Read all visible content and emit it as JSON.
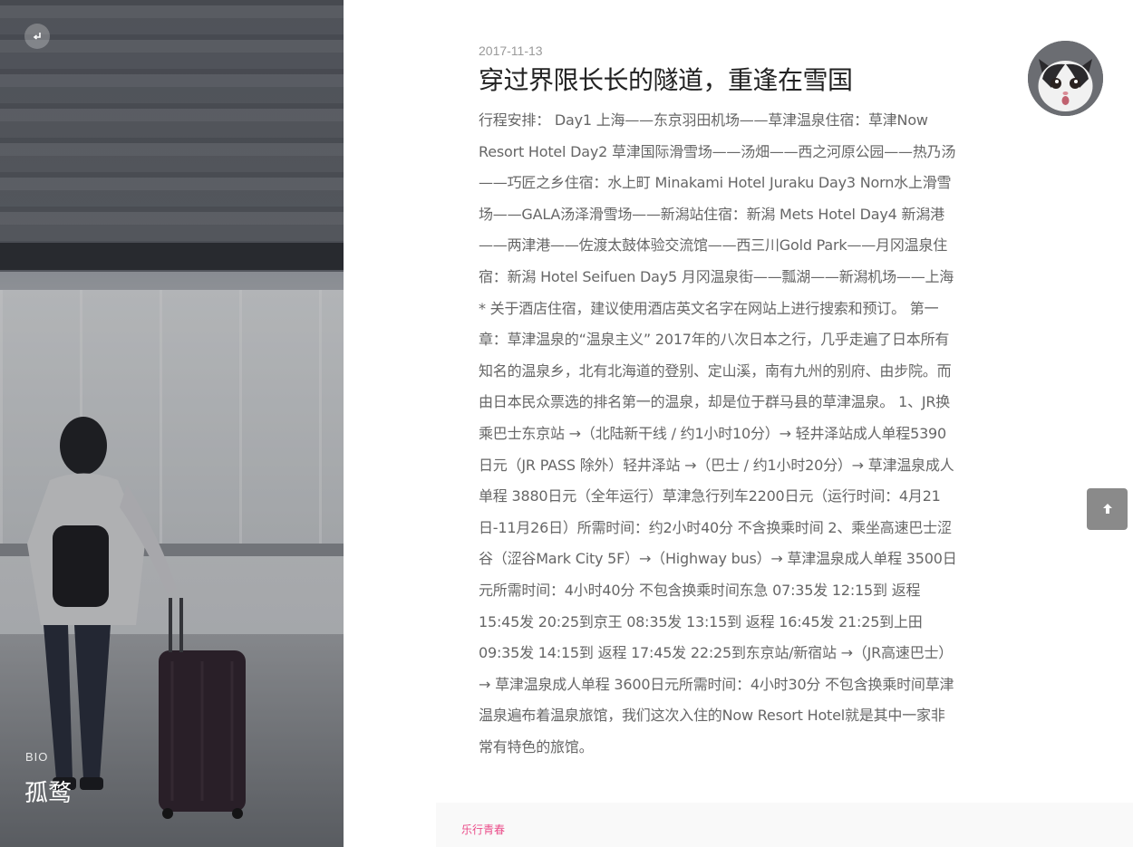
{
  "sidebar": {
    "bio_label": "BIO",
    "bio_name": "孤鹜",
    "back_icon": "back-arrow-icon"
  },
  "post": {
    "date": "2017-11-13",
    "title": "穿过界限长长的隧道，重逢在雪国",
    "body": "行程安排： Day1 上海——东京羽田机场——草津温泉住宿：草津Now Resort Hotel Day2 草津国际滑雪场——汤畑——西之河原公园——热乃汤——巧匠之乡住宿：水上町 Minakami Hotel Juraku Day3 Norn水上滑雪场——GALA汤泽滑雪场——新潟站住宿：新潟 Mets Hotel Day4 新潟港——两津港——佐渡太鼓体验交流馆——西三川Gold Park——月冈温泉住宿：新潟 Hotel Seifuen Day5 月冈温泉街——瓢湖——新潟机场——上海 * 关于酒店住宿，建议使用酒店英文名字在网站上进行搜索和预订。 第一章：草津温泉的“温泉主义” 2017年的八次日本之行，几乎走遍了日本所有知名的温泉乡，北有北海道的登别、定山溪，南有九州的别府、由步院。而由日本民众票选的排名第一的温泉，却是位于群马县的草津温泉。 1、JR换乘巴士东京站 →（北陆新干线 / 约1小时10分）→ 轻井泽站成人单程5390日元（JR PASS 除外）轻井泽站 →（巴士 / 约1小时20分）→ 草津温泉成人单程 3880日元（全年运行）草津急行列车2200日元（运行时间：4月21日-11月26日）所需时间：约2小时40分 不含换乘时间 2、乘坐高速巴士涩谷（涩谷Mark City 5F）→（Highway bus）→ 草津温泉成人单程 3500日元所需时间：4小时40分 不包含换乘时间东急 07:35发 12:15到 返程 15:45发 20:25到京王 08:35发 13:15到 返程 16:45发 21:25到上田 09:35发 14:15到 返程 17:45发 22:25到东京站/新宿站 →（JR高速巴士）→ 草津温泉成人单程 3600日元所需时间：4小时30分 不包含换乘时间草津温泉遍布着温泉旅馆，我们这次入住的Now Resort Hotel就是其中一家非常有特色的旅馆。"
  },
  "widgets": {
    "avatar_icon": "cat-avatar",
    "scroll_top_icon": "arrow-up-icon"
  },
  "footer": {
    "tag": "乐行青春",
    "tag_color": "#ea4c89"
  }
}
